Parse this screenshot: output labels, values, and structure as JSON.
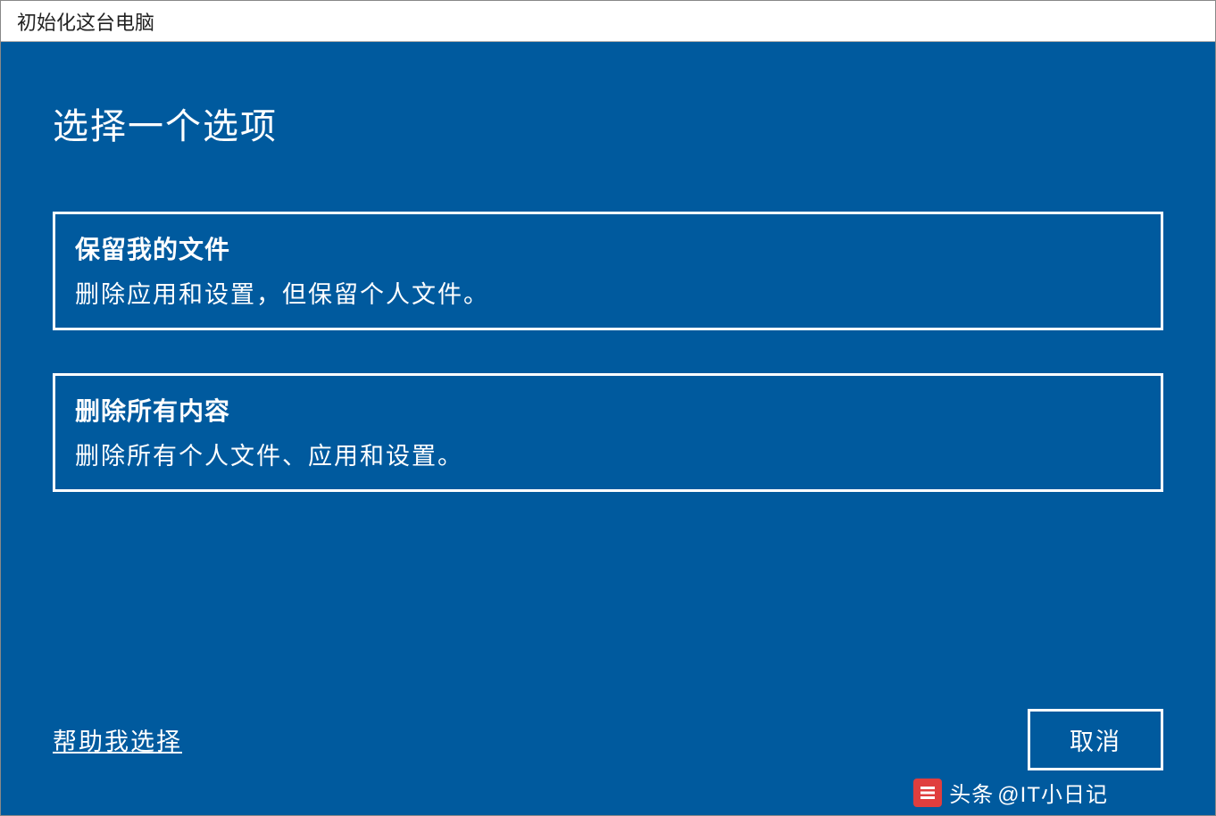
{
  "window": {
    "title": "初始化这台电脑"
  },
  "main": {
    "heading": "选择一个选项",
    "options": [
      {
        "title": "保留我的文件",
        "description": "删除应用和设置，但保留个人文件。"
      },
      {
        "title": "删除所有内容",
        "description": "删除所有个人文件、应用和设置。"
      }
    ]
  },
  "footer": {
    "help_link": "帮助我选择",
    "cancel_label": "取消"
  },
  "watermark": {
    "prefix": "头条",
    "text": "@IT小日记"
  }
}
